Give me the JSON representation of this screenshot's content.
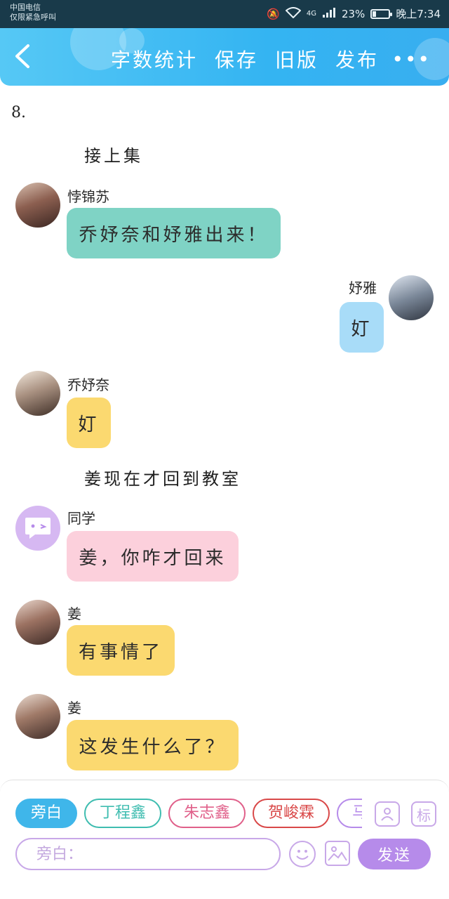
{
  "status_bar": {
    "carrier_line1": "中国电信",
    "carrier_line2": "仅限紧急呼叫",
    "network": "4G",
    "battery_percent": "23%",
    "battery_level": 0.23,
    "time": "晚上7:34"
  },
  "header": {
    "word_count": "字数统计",
    "save": "保存",
    "old_version": "旧版",
    "publish": "发布",
    "more": "•••"
  },
  "chat": {
    "episode": "8.",
    "narration1": "接上集",
    "narration2": "姜现在才回到教室",
    "messages": [
      {
        "name": "悖锦苏",
        "text": "乔妤奈和妤雅出来！",
        "color": "#7fd3c5",
        "side": "left"
      },
      {
        "name": "妤雅",
        "text": "奵",
        "color": "#a8dcf8",
        "side": "right"
      },
      {
        "name": "乔妤奈",
        "text": "奵",
        "color": "#fbd970",
        "side": "left"
      },
      {
        "name": "同学",
        "text": "姜，你咋才回来",
        "color": "#fcd0dc",
        "side": "left"
      },
      {
        "name": "姜",
        "text": "有事情了",
        "color": "#fbd970",
        "side": "left"
      },
      {
        "name": "姜",
        "text": "这发生什么了？",
        "color": "#fbd970",
        "side": "left"
      }
    ]
  },
  "panel": {
    "characters": [
      {
        "label": "旁白",
        "active": true,
        "color": "#3fb6ea"
      },
      {
        "label": "丁程鑫",
        "active": false,
        "color": "#3fbdb0"
      },
      {
        "label": "朱志鑫",
        "active": false,
        "color": "#e0608a"
      },
      {
        "label": "贺峻霖",
        "active": false,
        "color": "#d94848"
      },
      {
        "label": "马嘉",
        "active": false,
        "color": "#b68bea"
      }
    ],
    "tag_label": "标",
    "input_placeholder": "旁白：",
    "send_label": "发送"
  }
}
